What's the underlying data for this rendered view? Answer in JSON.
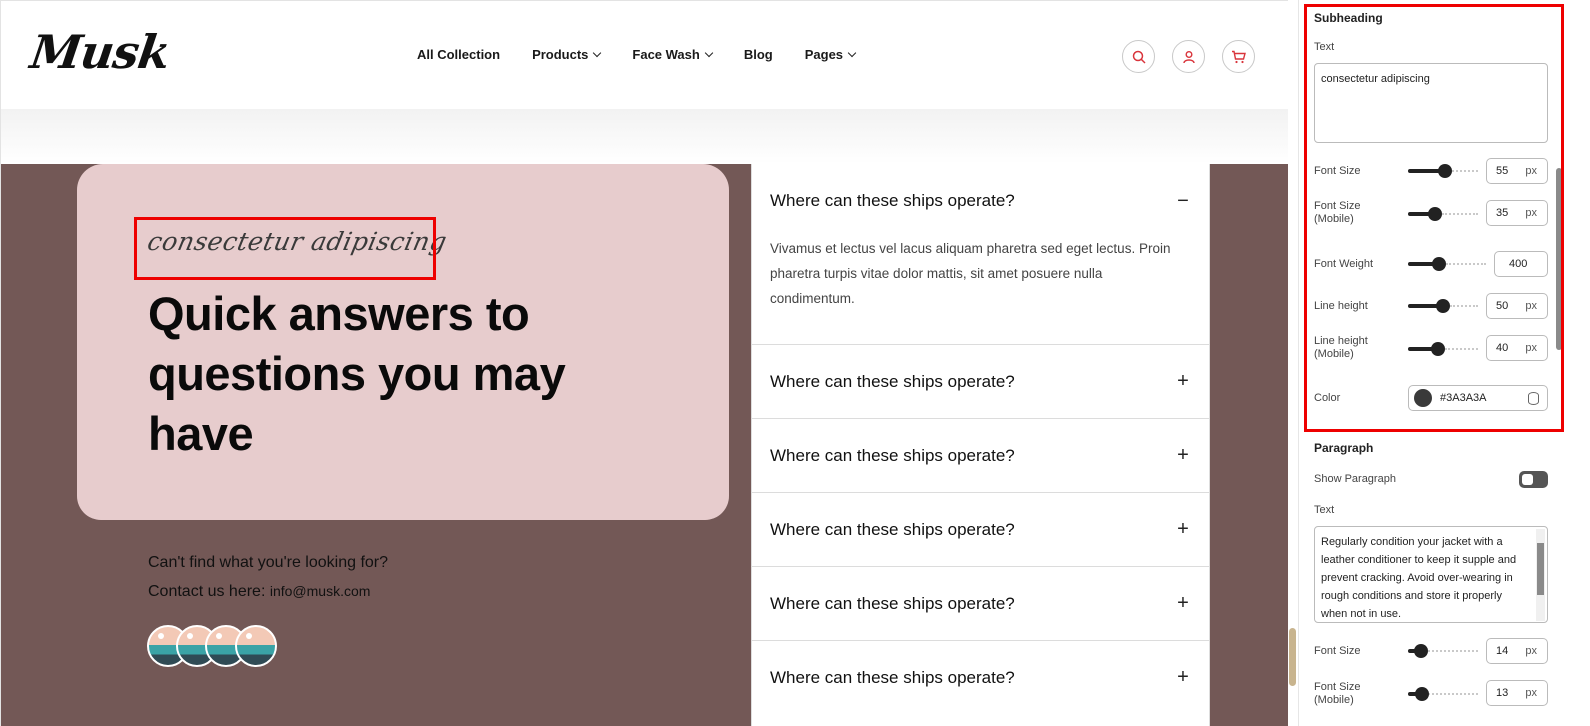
{
  "header": {
    "logo": "Musk",
    "nav": [
      {
        "label": "All Collection",
        "dropdown": false
      },
      {
        "label": "Products",
        "dropdown": true
      },
      {
        "label": "Face Wash",
        "dropdown": true
      },
      {
        "label": "Blog",
        "dropdown": false
      },
      {
        "label": "Pages",
        "dropdown": true
      }
    ],
    "icons": [
      "search-icon",
      "user-icon",
      "cart-icon"
    ],
    "icon_color": "#d9343b"
  },
  "hero": {
    "subheading": "consectetur adipiscing",
    "title": "Quick answers to questions you may have",
    "contact_question": "Can't find what you're looking for?",
    "contact_prefix": "Contact us here:",
    "contact_email": "info@musk.com",
    "card_color": "#e7cccd",
    "section_color": "#735856"
  },
  "faq": [
    {
      "question": "Where can these ships operate?",
      "answer": "Vivamus et lectus vel lacus aliquam pharetra sed eget lectus. Proin pharetra turpis vitae dolor mattis, sit amet posuere nulla condimentum.",
      "open": true,
      "toggle": "−"
    },
    {
      "question": "Where can these ships operate?",
      "open": false,
      "toggle": "+"
    },
    {
      "question": "Where can these ships operate?",
      "open": false,
      "toggle": "+"
    },
    {
      "question": "Where can these ships operate?",
      "open": false,
      "toggle": "+"
    },
    {
      "question": "Where can these ships operate?",
      "open": false,
      "toggle": "+"
    },
    {
      "question": "Where can these ships operate?",
      "open": false,
      "toggle": "+"
    }
  ],
  "panel": {
    "subheading": {
      "title": "Subheading",
      "text_label": "Text",
      "text_value": "consectetur adipiscing",
      "font_size_label": "Font Size",
      "font_size": "55",
      "font_size_mobile_label": "Font Size (Mobile)",
      "font_size_mobile": "35",
      "font_weight_label": "Font Weight",
      "font_weight": "400",
      "line_height_label": "Line height",
      "line_height": "50",
      "line_height_mobile_label": "Line height (Mobile)",
      "line_height_mobile": "40",
      "color_label": "Color",
      "color_value": "#3A3A3A",
      "unit": "px"
    },
    "paragraph": {
      "title": "Paragraph",
      "show_label": "Show Paragraph",
      "text_label": "Text",
      "text_value": "Regularly condition your jacket with a leather conditioner to keep it supple and prevent cracking. Avoid over-wearing in rough conditions and store it properly when not in use.",
      "font_size_label": "Font Size",
      "font_size": "14",
      "font_size_mobile_label": "Font Size (Mobile)",
      "font_size_mobile": "13",
      "unit": "px"
    }
  }
}
